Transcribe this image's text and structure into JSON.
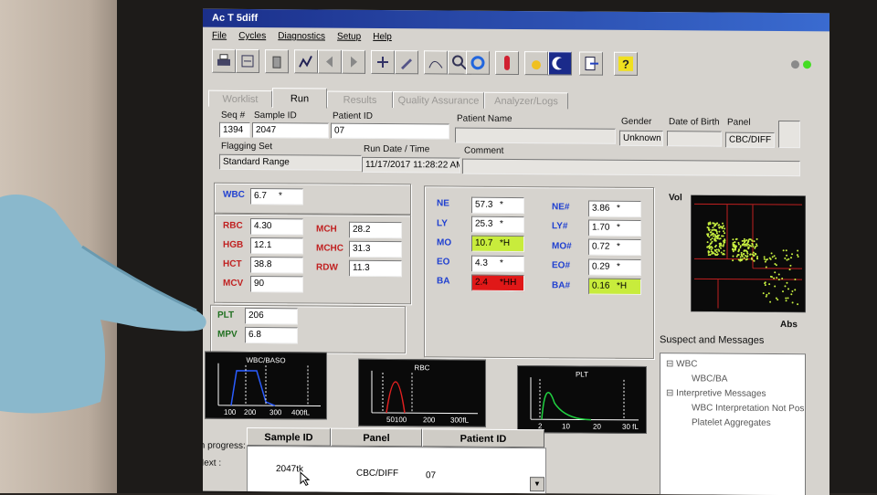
{
  "window": {
    "title": "Ac T 5diff"
  },
  "menu": [
    "File",
    "Cycles",
    "Diagnostics",
    "Setup",
    "Help"
  ],
  "toolbar": {
    "icons": [
      "printer-icon",
      "export-icon",
      "trash-icon",
      "run-icon",
      "prev-icon",
      "next-icon",
      "calibrate-icon",
      "edit-icon",
      "graph-icon",
      "search-icon",
      "refresh-icon",
      "tube-icon",
      "startup-icon",
      "shutdown-icon",
      "exit-icon",
      "help-icon"
    ],
    "status_colors": [
      "#8a8a8a",
      "#44dd22"
    ]
  },
  "tabs": [
    "Worklist",
    "Run",
    "Results",
    "Quality Assurance",
    "Analyzer/Logs"
  ],
  "active_tab": "Run",
  "patient": {
    "seq_label": "Seq #",
    "seq": "1394",
    "sample_label": "Sample ID",
    "sample": "2047",
    "patient_id_label": "Patient ID",
    "patient_id": "07",
    "name_label": "Patient Name",
    "name": "",
    "gender_label": "Gender",
    "gender": "Unknown",
    "dob_label": "Date of Birth",
    "dob": "",
    "panel_label": "Panel",
    "panel": "CBC/DIFF",
    "flagging_label": "Flagging Set",
    "flagging": "Standard Range",
    "rundate_label": "Run Date / Time",
    "rundate": "11/17/2017 11:28:22 AM",
    "comment_label": "Comment",
    "comment": ""
  },
  "results": {
    "wbc": {
      "label": "WBC",
      "value": "6.7",
      "flag": "*"
    },
    "rbc_group": [
      {
        "label": "RBC",
        "value": "4.30",
        "flag": ""
      },
      {
        "label": "HGB",
        "value": "12.1",
        "flag": ""
      },
      {
        "label": "HCT",
        "value": "38.8",
        "flag": ""
      },
      {
        "label": "MCV",
        "value": "90",
        "flag": ""
      }
    ],
    "rbc_group2": [
      {
        "label": "MCH",
        "value": "28.2",
        "flag": ""
      },
      {
        "label": "MCHC",
        "value": "31.3",
        "flag": ""
      },
      {
        "label": "RDW",
        "value": "11.3",
        "flag": ""
      }
    ],
    "plt_group": [
      {
        "label": "PLT",
        "value": "206",
        "flag": ""
      },
      {
        "label": "MPV",
        "value": "6.8",
        "flag": ""
      }
    ],
    "diff_pct": [
      {
        "label": "NE",
        "value": "57.3",
        "flag": "*"
      },
      {
        "label": "LY",
        "value": "25.3",
        "flag": "*"
      },
      {
        "label": "MO",
        "value": "10.7",
        "flag": "*H"
      },
      {
        "label": "EO",
        "value": "4.3",
        "flag": "*"
      },
      {
        "label": "BA",
        "value": "2.4",
        "flag": "*HH"
      }
    ],
    "diff_abs": [
      {
        "label": "NE#",
        "value": "3.86",
        "flag": "*"
      },
      {
        "label": "LY#",
        "value": "1.70",
        "flag": "*"
      },
      {
        "label": "MO#",
        "value": "0.72",
        "flag": "*"
      },
      {
        "label": "EO#",
        "value": "0.29",
        "flag": "*"
      },
      {
        "label": "BA#",
        "value": "0.16",
        "flag": "*H"
      }
    ]
  },
  "scatter": {
    "top_label": "Vol",
    "bottom_label": "Abs",
    "point_color": "#c8f040"
  },
  "histograms": [
    {
      "title": "WBC/BASO",
      "ticks": [
        "100",
        "200",
        "300",
        "400fL"
      ],
      "color": "#2a5cff"
    },
    {
      "title": "RBC",
      "ticks": [
        "50100",
        "200",
        "300fL"
      ],
      "color": "#e02020"
    },
    {
      "title": "PLT",
      "ticks": [
        "2",
        "10",
        "20",
        "30 fL"
      ],
      "color": "#20d040"
    }
  ],
  "messages": {
    "title": "Suspect and Messages",
    "items": [
      "WBC",
      "WBC/BA",
      "Interpretive Messages",
      "WBC Interpretation Not Pos",
      "Platelet Aggregates"
    ]
  },
  "queue": {
    "in_progress_label": "In progress:",
    "next_label": "Next :",
    "headers": [
      "Sample ID",
      "Panel",
      "Patient ID"
    ],
    "next_row": {
      "sample": "2047tk",
      "panel": "CBC/DIFF",
      "patient": "07"
    }
  }
}
